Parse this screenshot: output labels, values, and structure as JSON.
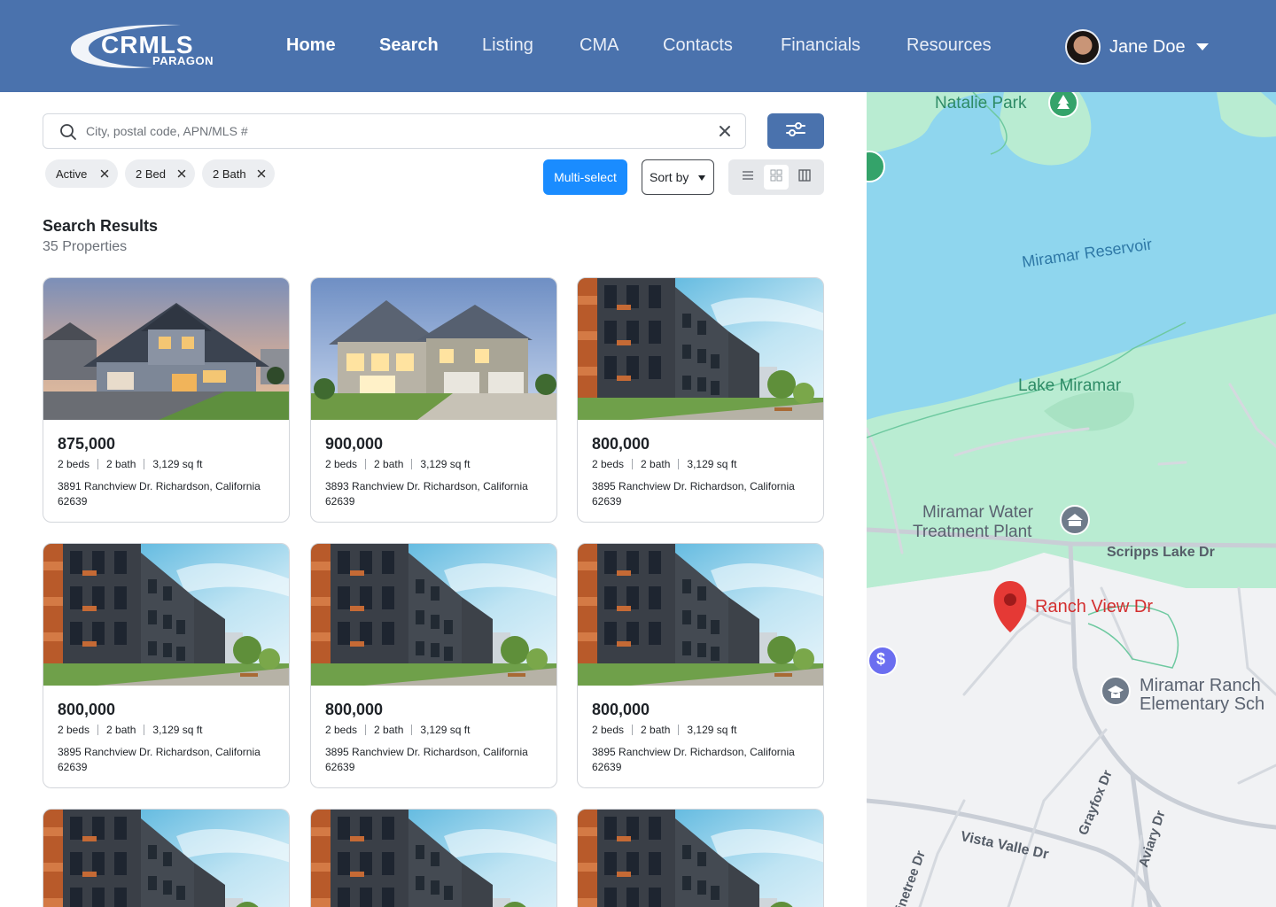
{
  "header": {
    "logo_main": "CRMLS",
    "logo_sub": "PARAGON",
    "nav": [
      "Home",
      "Search",
      "Listing",
      "CMA",
      "Contacts",
      "Financials",
      "Resources"
    ],
    "user_name": "Jane Doe"
  },
  "search": {
    "placeholder": "City, postal code, APN/MLS #"
  },
  "filters": {
    "chips": [
      "Active",
      "2 Bed",
      "2 Bath"
    ]
  },
  "toolbar": {
    "multi_select": "Multi-select",
    "sort_by": "Sort by"
  },
  "results": {
    "title": "Search Results",
    "count": "35 Properties"
  },
  "listings": [
    {
      "price": "875,000",
      "beds": "2 beds",
      "baths": "2 bath",
      "sqft": "3,129 sq ft",
      "address": "3891 Ranchview Dr. Richardson, California 62639",
      "photo": "suburban-house-dusk"
    },
    {
      "price": "900,000",
      "beds": "2 beds",
      "baths": "2 bath",
      "sqft": "3,129 sq ft",
      "address": "3893 Ranchview Dr. Richardson, California 62639",
      "photo": "two-story-house-evening"
    },
    {
      "price": "800,000",
      "beds": "2 beds",
      "baths": "2 bath",
      "sqft": "3,129 sq ft",
      "address": "3895 Ranchview Dr. Richardson, California 62639",
      "photo": "apartment-building"
    },
    {
      "price": "800,000",
      "beds": "2 beds",
      "baths": "2 bath",
      "sqft": "3,129 sq ft",
      "address": "3895 Ranchview Dr. Richardson, California 62639",
      "photo": "apartment-building"
    },
    {
      "price": "800,000",
      "beds": "2 beds",
      "baths": "2 bath",
      "sqft": "3,129 sq ft",
      "address": "3895 Ranchview Dr. Richardson, California 62639",
      "photo": "apartment-building"
    },
    {
      "price": "800,000",
      "beds": "2 beds",
      "baths": "2 bath",
      "sqft": "3,129 sq ft",
      "address": "3895 Ranchview Dr. Richardson, California 62639",
      "photo": "apartment-building"
    },
    {
      "photo": "apartment-building"
    },
    {
      "photo": "apartment-building"
    },
    {
      "photo": "apartment-building"
    }
  ],
  "map": {
    "labels": {
      "natalie_park": "Natalie Park",
      "reservoir": "Miramar Reservoir",
      "lake": "Lake Miramar",
      "water_plant_1": "Miramar Water",
      "water_plant_2": "Treatment Plant",
      "scripps": "Scripps Lake Dr",
      "ranch_view": "Ranch View Dr",
      "school_1": "Miramar Ranch",
      "school_2": "Elementary Sch",
      "grayfox": "Grayfox Dr",
      "aviary": "Aviary Dr",
      "vista": "Vista Valle Dr",
      "pinetree": "inetree Dr"
    },
    "pin_color": "#e53935",
    "water_color": "#8fd6ee",
    "park_color": "#b9ecd2"
  },
  "colors": {
    "header_bg": "#4a72ad",
    "primary_button": "#1a8cff"
  }
}
